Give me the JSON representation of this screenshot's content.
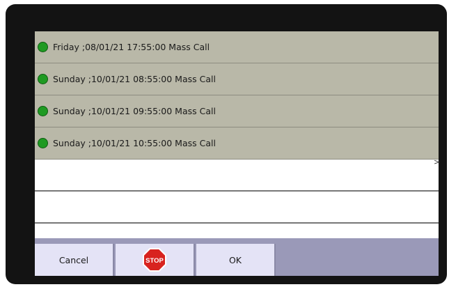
{
  "events": [
    {
      "text": "Friday ;08/01/21 17:55:00 Mass Call",
      "status_color": "#1f9a22"
    },
    {
      "text": "Sunday ;10/01/21 08:55:00 Mass Call",
      "status_color": "#1f9a22"
    },
    {
      "text": "Sunday ;10/01/21 09:55:00 Mass Call",
      "status_color": "#1f9a22"
    },
    {
      "text": "Sunday ;10/01/21 10:55:00 Mass Call",
      "status_color": "#1f9a22"
    }
  ],
  "scroll_indicator": ">",
  "buttons": {
    "cancel_label": "Cancel",
    "stop_label": "STOP",
    "ok_label": "OK"
  }
}
